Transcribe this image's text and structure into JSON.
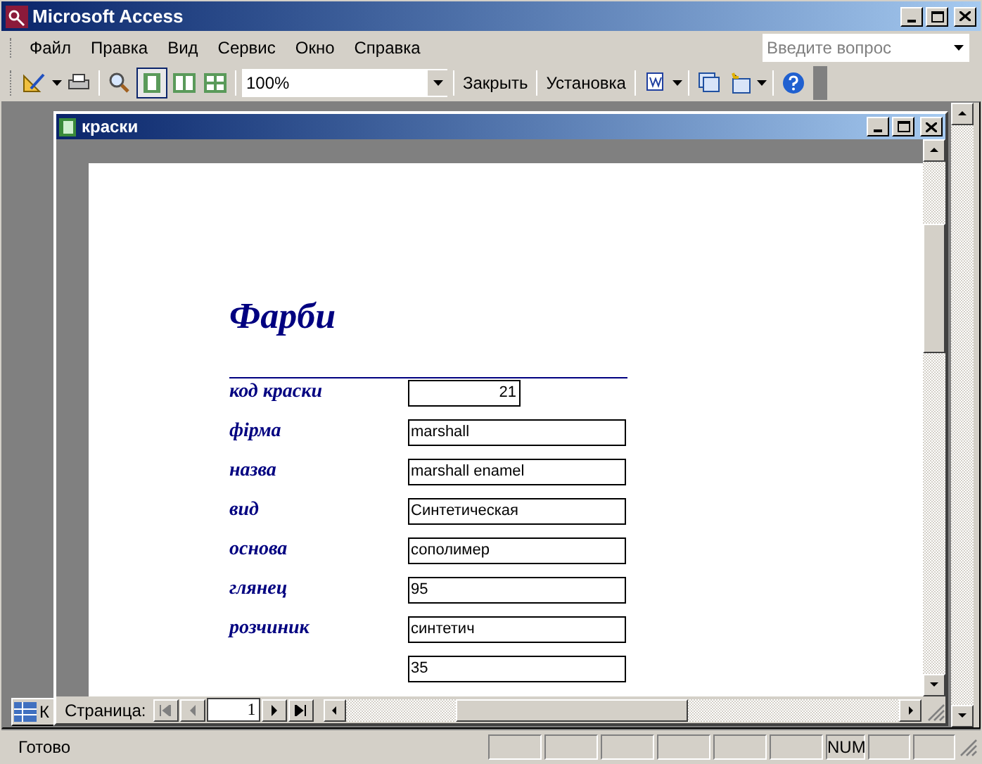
{
  "window": {
    "title": "Microsoft Access"
  },
  "menu": [
    "Файл",
    "Правка",
    "Вид",
    "Сервис",
    "Окно",
    "Справка"
  ],
  "help_search": {
    "placeholder": "Введите вопрос"
  },
  "toolbar": {
    "zoom": "100%",
    "buttons": [
      "Закрыть",
      "Установка"
    ]
  },
  "report_window": {
    "title": "краски"
  },
  "report": {
    "title": "Фарби",
    "fields": [
      {
        "label": "код краски",
        "value": "21",
        "kind": "number"
      },
      {
        "label": "фірма",
        "value": "marshall",
        "kind": "text"
      },
      {
        "label": "назва",
        "value": "marshall enamel",
        "kind": "text"
      },
      {
        "label": "вид",
        "value": "Синтетическая",
        "kind": "text"
      },
      {
        "label": "основа",
        "value": "сополимер",
        "kind": "text"
      },
      {
        "label": "глянец",
        "value": "95",
        "kind": "text"
      },
      {
        "label": "розчиник",
        "value": "синтетич",
        "kind": "text"
      },
      {
        "value": "35",
        "kind": "text"
      }
    ]
  },
  "navigation": {
    "label": "Страница:",
    "page": "1"
  },
  "minimized_window": {
    "title": "К"
  },
  "status_bar": {
    "text": "Готово",
    "indicators": [
      "NUM"
    ]
  }
}
